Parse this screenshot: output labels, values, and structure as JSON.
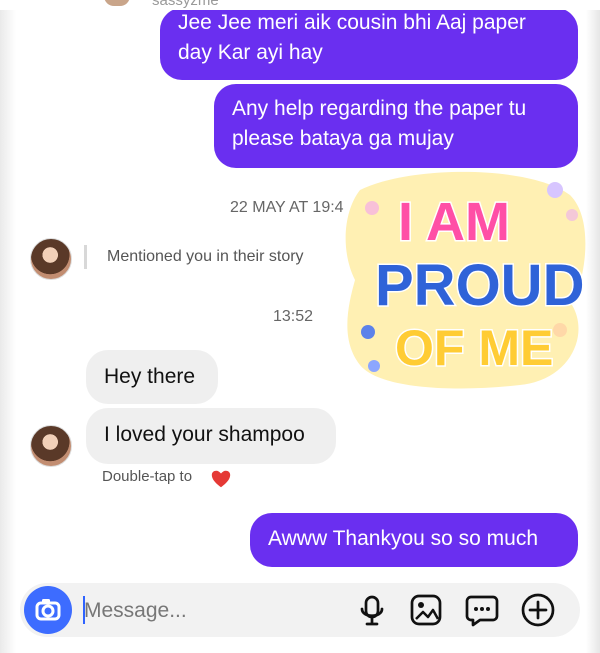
{
  "header": {
    "name_fragment": "sassyzme"
  },
  "messages": [
    {
      "type": "sent",
      "lines": [
        "Jee Jee meri aik cousin bhi Aaj paper",
        "day Kar ayi hay"
      ]
    },
    {
      "type": "sent",
      "lines": [
        "Any help regarding the paper tu",
        "please bataya ga mujay"
      ]
    },
    {
      "type": "timestamp",
      "text": "22 MAY AT 19:4"
    },
    {
      "type": "story_mention",
      "text": "Mentioned you in their story"
    },
    {
      "type": "timestamp",
      "text": "13:52"
    },
    {
      "type": "received",
      "text": "Hey there"
    },
    {
      "type": "received",
      "text": "I loved your shampoo"
    },
    {
      "type": "hint",
      "text": "Double-tap to"
    },
    {
      "type": "sent",
      "text": "Awww Thankyou so so much"
    }
  ],
  "sticker": {
    "lines": [
      "I AM",
      "PROUD",
      "OF ME"
    ]
  },
  "composer": {
    "placeholder": "Message...",
    "icons": [
      "camera-icon",
      "microphone-icon",
      "image-icon",
      "sticker-icon",
      "add-icon"
    ]
  },
  "colors": {
    "sent_bubble": "#6a2ff0",
    "received_bubble": "#efefef",
    "camera_button": "#3d6cff",
    "heart": "#e53935"
  }
}
